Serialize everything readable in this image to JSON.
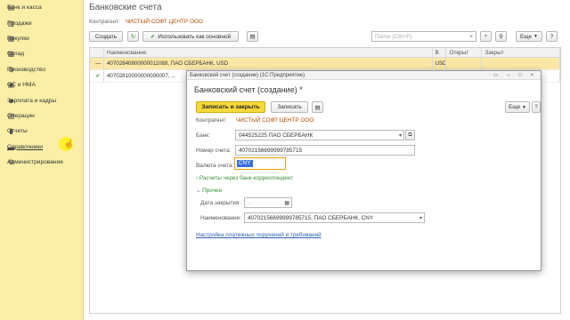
{
  "sidebar": {
    "items": [
      {
        "icon": "bank-icon",
        "glyph": "▤",
        "label": "Банк и касса"
      },
      {
        "icon": "sales-icon",
        "glyph": "▥",
        "label": "Продажи"
      },
      {
        "icon": "purchases-icon",
        "glyph": "▦",
        "label": "Покупки"
      },
      {
        "icon": "warehouse-icon",
        "glyph": "▩",
        "label": "Склад"
      },
      {
        "icon": "production-icon",
        "glyph": "⚙",
        "label": "Производство"
      },
      {
        "icon": "assets-icon",
        "glyph": "▣",
        "label": "ОС и НМА"
      },
      {
        "icon": "salary-icon",
        "glyph": "☻",
        "label": "Зарплата и кадры"
      },
      {
        "icon": "operations-icon",
        "glyph": "▧",
        "label": "Операции"
      },
      {
        "icon": "reports-icon",
        "glyph": "▮",
        "label": "Отчеты"
      },
      {
        "icon": "reference-icon",
        "glyph": "▬",
        "label": "Справочники"
      },
      {
        "icon": "admin-icon",
        "glyph": "⚙",
        "label": "Администрирование"
      }
    ]
  },
  "list_form": {
    "title": "Банковские счета",
    "counterparty_label": "Контрагент:",
    "counterparty_value": "ЧИСТЫЙ СОФТ ЦЕНТР ООО",
    "toolbar": {
      "create": "Создать",
      "use_as_main": "Использовать как основной",
      "search_placeholder": "Поиск (Ctrl+F)",
      "more": "Еще"
    },
    "columns": [
      "",
      "Наименование",
      "В",
      "Открыт",
      "Закрыт"
    ],
    "rows": [
      {
        "mark": "—",
        "name": "40702840800000011088, ПАО СБЕРБАНК, USD",
        "cur": "USD",
        "opened": "",
        "closed": ""
      },
      {
        "mark": "✔",
        "name": "40702810000000000007, ...",
        "cur": "",
        "opened": "",
        "closed": ""
      }
    ]
  },
  "dialog": {
    "window_caption": "Банковский счет (создание) (1С:Предприятие)",
    "title": "Банковский счет (создание) *",
    "buttons": {
      "save_close": "Записать и закрыть",
      "save": "Записать",
      "more": "Еще"
    },
    "counterparty_label": "Контрагент:",
    "counterparty_value": "ЧИСТЫЙ СОФТ ЦЕНТР ООО",
    "bank_label": "Банк:",
    "bank_value": "044525225 ПАО СБЕРБАНК",
    "account_label": "Номер счета:",
    "account_value": "40702156699999785715",
    "currency_label": "Валюта счета:",
    "currency_value": "CNY",
    "correspondent_group": "Расчеты через банк-корреспондент",
    "other_group": "Прочее",
    "close_date_label": "Дата закрытия:",
    "close_date_value": ". .",
    "name_label": "Наименование:",
    "name_value": "40702156699999785715, ПАО СБЕРБАНК, CNY",
    "settings_link": "Настройка платежных поручений и требований"
  }
}
